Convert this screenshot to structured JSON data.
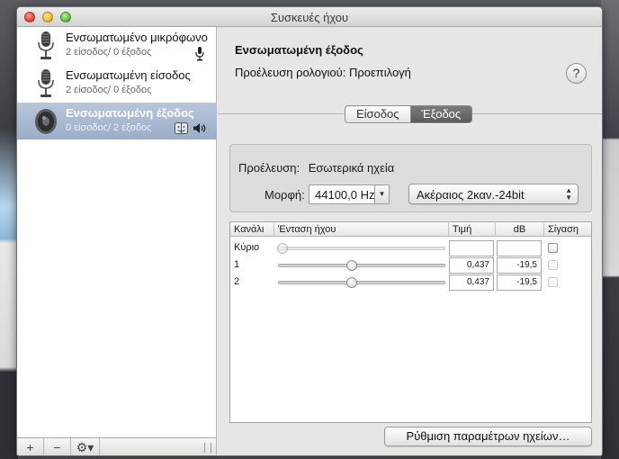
{
  "window": {
    "title": "Συσκευές ήχου"
  },
  "sidebar": {
    "devices": [
      {
        "name": "Ενσωματωμένο μικρόφωνο",
        "io": "2 είσοδος/ 0 έξοδος",
        "icon": "microphone-icon"
      },
      {
        "name": "Ενσωματωμένη είσοδος",
        "io": "2 είσοδος/ 0 έξοδος",
        "icon": "microphone-icon"
      },
      {
        "name": "Ενσωματωμένη έξοδος",
        "io": "0 είσοδος/ 2 έξοδος",
        "icon": "speaker-icon",
        "selected": true
      }
    ],
    "toolbar": {
      "add_label": "+",
      "remove_label": "−",
      "gear_label": "⚙▾"
    }
  },
  "detail": {
    "device_title": "Ενσωματωμένη έξοδος",
    "clock_label": "Προέλευση ρολογιού:",
    "clock_value": "Προεπιλογή",
    "help_label": "?",
    "tabs": {
      "input": "Είσοδος",
      "output": "Έξοδος",
      "active": "output"
    },
    "source_label": "Προέλευση:",
    "source_value": "Εσωτερικά ηχεία",
    "format_label": "Μορφή:",
    "sample_rate": "44100,0 Hz",
    "bit_format": "Ακέραιος 2καν.-24bit",
    "table": {
      "headers": [
        "Κανάλι",
        "Ένταση ήχου",
        "Τιμή",
        "dB",
        "Σίγαση"
      ],
      "rows": [
        {
          "channel": "Κύριο",
          "volume": 0.0,
          "value": "",
          "db": "",
          "muted": false,
          "enabled": false
        },
        {
          "channel": "1",
          "volume": 0.437,
          "value": "0,437",
          "db": "-19,5",
          "muted": false,
          "enabled": true
        },
        {
          "channel": "2",
          "volume": 0.437,
          "value": "0,437",
          "db": "-19,5",
          "muted": false,
          "enabled": true
        }
      ]
    },
    "configure_button": "Ρύθμιση παραμέτρων ηχείων…"
  },
  "colors": {
    "selection": "#a6b6cf",
    "active_tab": "#666666"
  }
}
